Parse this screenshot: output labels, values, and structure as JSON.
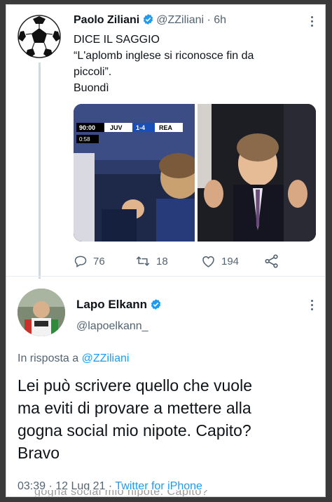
{
  "tweet": {
    "author_name": "Paolo Ziliani",
    "handle": "@ZZiliani",
    "age": "6h",
    "separator": "·",
    "lines": [
      "DICE IL SAGGIO",
      "“L'aplomb inglese si riconosce fin da",
      "piccoli”.",
      "Buondì"
    ],
    "media": {
      "scoreboard": {
        "clock": "90:00",
        "home": "JUV",
        "score": "1-4",
        "away": "REA",
        "added": "0:58"
      }
    },
    "actions": {
      "replies": "76",
      "retweets": "18",
      "likes": "194"
    }
  },
  "reply": {
    "author_name": "Lapo Elkann",
    "handle": "@lapoelkann_",
    "replying_prefix": "In risposta a",
    "replying_to": "@ZZiliani",
    "lines": [
      "Lei può scrivere quello che vuole",
      "ma eviti di provare a mettere alla",
      "gogna social mio nipote. Capito?",
      "Bravo"
    ],
    "time": "03:39",
    "date": "12 Lug 21",
    "dot": "·",
    "source": "Twitter for iPhone"
  },
  "bleed_text": "gogna social mio nipote. Capito?",
  "colors": {
    "verified": "#1d9bf0",
    "link": "#1d9bf0",
    "muted": "#536471",
    "text": "#0f1419"
  },
  "icons": [
    "soccer-ball-avatar",
    "verified-badge-icon",
    "more-icon",
    "reply-icon",
    "retweet-icon",
    "like-icon",
    "share-icon"
  ]
}
